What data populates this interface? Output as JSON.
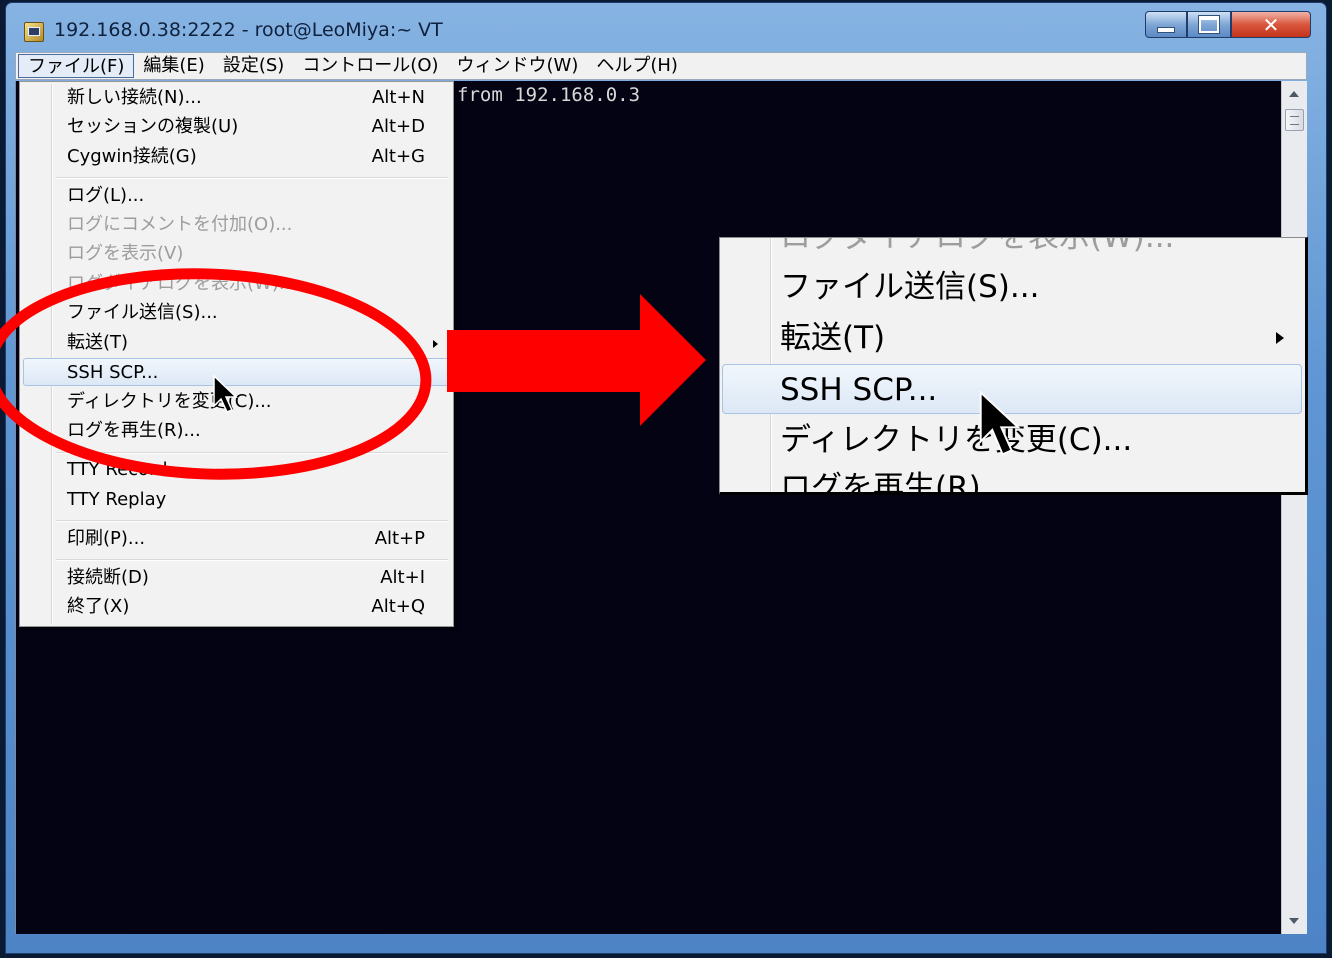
{
  "window": {
    "title": "192.168.0.38:2222 - root@LeoMiya:~ VT"
  },
  "menubar": {
    "items": [
      {
        "label": "ファイル(F)",
        "active": true
      },
      {
        "label": "編集(E)"
      },
      {
        "label": "設定(S)"
      },
      {
        "label": "コントロール(O)"
      },
      {
        "label": "ウィンドウ(W)"
      },
      {
        "label": "ヘルプ(H)"
      }
    ]
  },
  "terminal": {
    "line": "from 192.168.0.3"
  },
  "file_menu": {
    "items": [
      {
        "label": "新しい接続(N)...",
        "shortcut": "Alt+N"
      },
      {
        "label": "セッションの複製(U)",
        "shortcut": "Alt+D"
      },
      {
        "label": "Cygwin接続(G)",
        "shortcut": "Alt+G"
      },
      {
        "label": "ログ(L)..."
      },
      {
        "label": "ログにコメントを付加(O)...",
        "disabled": true
      },
      {
        "label": "ログを表示(V)",
        "disabled": true
      },
      {
        "label": "ログダイアログを表示(W)...",
        "disabled": true
      },
      {
        "label": "ファイル送信(S)..."
      },
      {
        "label": "転送(T)",
        "submenu": true
      },
      {
        "label": "SSH SCP...",
        "highlighted": true
      },
      {
        "label": "ディレクトリを変更(C)..."
      },
      {
        "label": "ログを再生(R)..."
      },
      {
        "label": "TTY Record"
      },
      {
        "label": "TTY Replay"
      },
      {
        "label": "印刷(P)...",
        "shortcut": "Alt+P"
      },
      {
        "label": "接続断(D)",
        "shortcut": "Alt+I"
      },
      {
        "label": "終了(X)",
        "shortcut": "Alt+Q"
      }
    ]
  },
  "zoom_callout": {
    "items": [
      {
        "label": "ログダイアログを表示(W)...",
        "disabled": true
      },
      {
        "label": "ファイル送信(S)..."
      },
      {
        "label": "転送(T)",
        "submenu": true
      },
      {
        "label": "SSH SCP...",
        "highlighted": true
      },
      {
        "label": "ディレクトリを変更(C)..."
      },
      {
        "label": "ログを再生(R)..."
      }
    ]
  },
  "annotation": {
    "color": "#ff0000"
  }
}
